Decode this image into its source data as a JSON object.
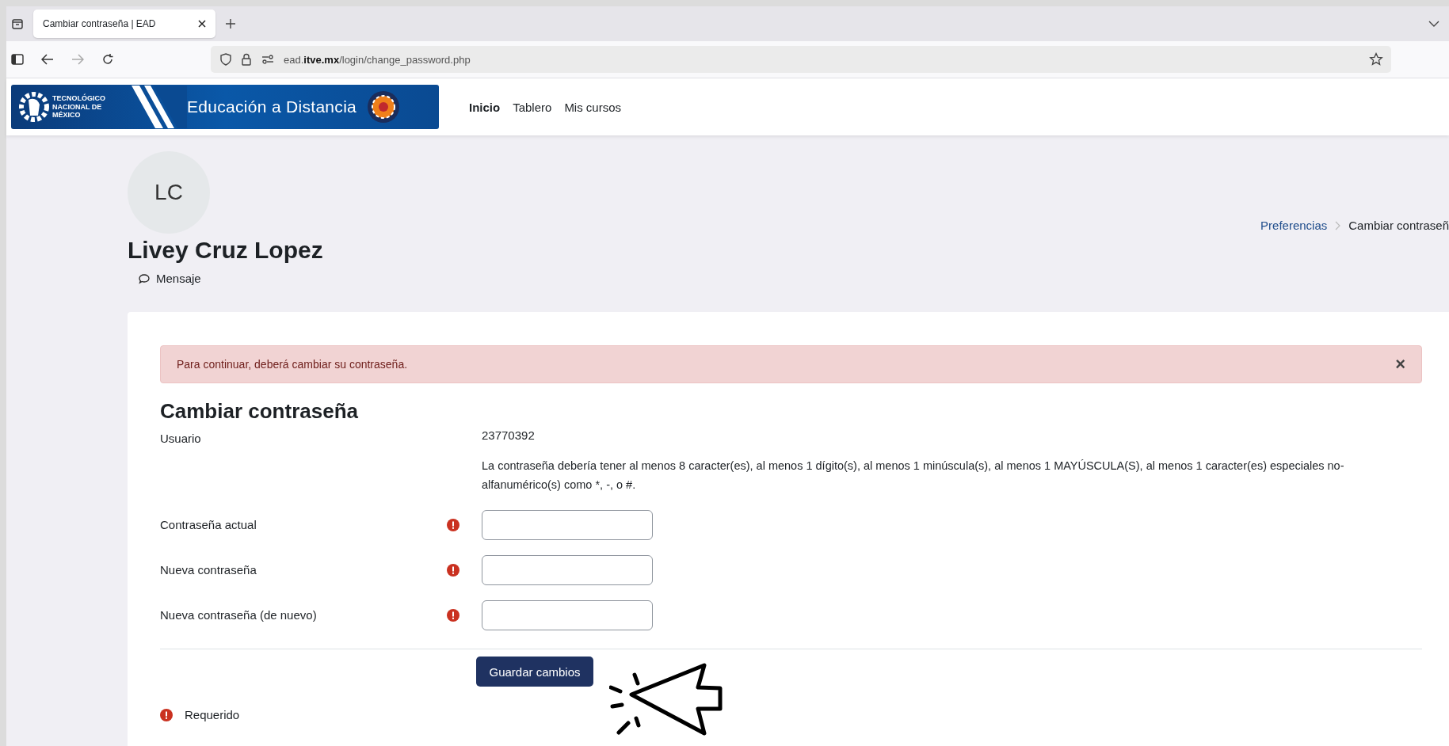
{
  "browser": {
    "tab_title": "Cambiar contraseña | EAD",
    "url_host": "ead.",
    "url_domain": "itve.mx",
    "url_path": "/login/change_password.php"
  },
  "header": {
    "brand": "Educación a Distancia",
    "logo_text": "TECNOLÓGICO NACIONAL DE MÉXICO",
    "nav": [
      {
        "label": "Inicio",
        "selected": true
      },
      {
        "label": "Tablero",
        "selected": false
      },
      {
        "label": "Mis cursos",
        "selected": false
      }
    ]
  },
  "profile": {
    "initials": "LC",
    "name": "Livey Cruz Lopez",
    "message_link": "Mensaje"
  },
  "breadcrumb": [
    "Preferencias",
    "Cambiar contraseñ"
  ],
  "alert": {
    "text": "Para continuar, deberá cambiar su contraseña.",
    "close": "×"
  },
  "form": {
    "title": "Cambiar contraseña",
    "username_label": "Usuario",
    "username": "23770392",
    "policy": "La contraseña debería tener al menos 8 caracter(es), al menos 1 dígito(s), al menos 1 minúscula(s), al menos 1 MAYÚSCULA(S), al menos 1 caracter(es) especiales no-alfanumérico(s) como *, -, o #.",
    "fields": [
      {
        "label": "Contraseña actual",
        "required": true
      },
      {
        "label": "Nueva contraseña",
        "required": true
      },
      {
        "label": "Nueva contraseña (de nuevo)",
        "required": true
      }
    ],
    "submit": "Guardar cambios",
    "required_note": "Requerido"
  }
}
